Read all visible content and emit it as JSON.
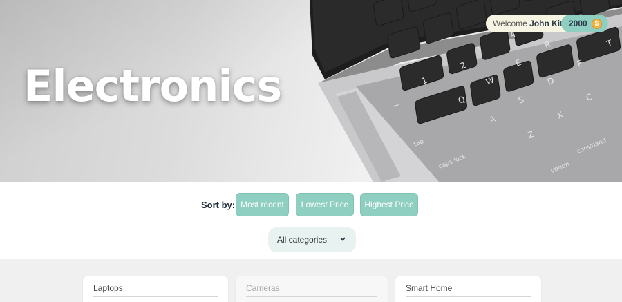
{
  "hero": {
    "title": "Electronics"
  },
  "user": {
    "welcome_prefix": "Welcome ",
    "name": "John Kite",
    "welcome_suffix": "!",
    "coins": "2000",
    "coin_symbol": "$"
  },
  "sort": {
    "label": "Sort by:",
    "options": [
      "Most recent",
      "Lowest Price",
      "Highest Price"
    ]
  },
  "category_filter": {
    "selected": "All categories"
  },
  "categories": [
    {
      "title": "Laptops"
    },
    {
      "title": "Cameras"
    },
    {
      "title": "Smart Home"
    }
  ],
  "colors": {
    "accent": "#8ecfc1",
    "pill_bg": "#f6f4e2",
    "select_bg": "#e8f3f1",
    "dark_text": "#1f2d3a",
    "coin": "#f2b441"
  }
}
